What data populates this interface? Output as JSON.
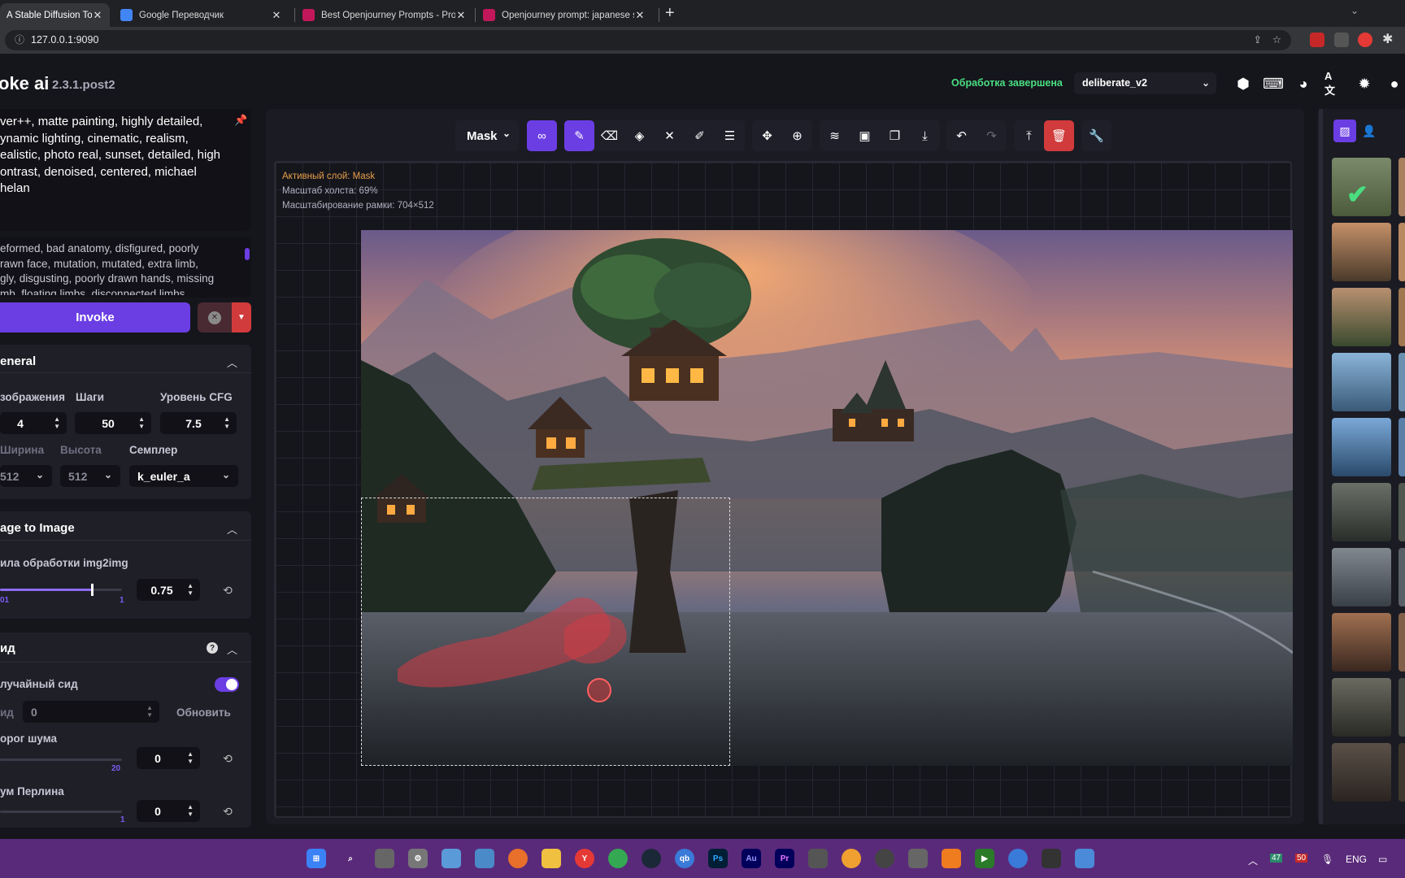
{
  "browser": {
    "tabs": [
      {
        "title": "A Stable Diffusion Too",
        "active": true,
        "favicon_color": "#202124"
      },
      {
        "title": "Google Переводчик",
        "active": false,
        "favicon_color": "#4285f4"
      },
      {
        "title": "Best Openjourney Prompts - Pro",
        "active": false,
        "favicon_color": "#c2185b"
      },
      {
        "title": "Openjourney prompt: japanese s",
        "active": false,
        "favicon_color": "#c2185b"
      }
    ],
    "new_tab": "+",
    "url": "127.0.0.1:9090"
  },
  "header": {
    "logo": "oke ai",
    "version": "2.3.1.post2",
    "status": "Обработка завершена",
    "model": "deliberate_v2"
  },
  "prompt": {
    "positive": "ver++, matte painting, highly detailed,\nynamic lighting, cinematic, realism,\nealistic, photo real, sunset, detailed, high\nontrast, denoised, centered, michael\nhelan",
    "negative": "eformed, bad anatomy, disfigured, poorly\nrawn face, mutation, mutated, extra limb,\ngly, disgusting, poorly drawn hands, missing\nmb, floating limbs, disconnected limbs"
  },
  "invoke": {
    "label": "Invoke"
  },
  "general": {
    "title": "eneral",
    "images_label": "зображения",
    "steps_label": "Шаги",
    "cfg_label": "Уровень CFG",
    "images": "4",
    "steps": "50",
    "cfg": "7.5",
    "width_label": "Ширина",
    "height_label": "Высота",
    "sampler_label": "Семплер",
    "width": "512",
    "height": "512",
    "sampler": "k_euler_a"
  },
  "img2img": {
    "title": "age to Image",
    "strength_label": "ила обработки img2img",
    "strength": "0.75",
    "slider_min": "01",
    "slider_max": "1",
    "slider_value_fraction": 0.75
  },
  "seed": {
    "title": "ид",
    "random_label": "лучайный сид",
    "random_enabled": true,
    "seed_label": "ид",
    "seed_value": "0",
    "refresh_label": "Обновить",
    "noise_threshold_label": "орог шума",
    "noise_threshold": "0",
    "noise_max": "20",
    "perlin_label": "ум Перлина",
    "perlin": "0",
    "perlin_max": "1"
  },
  "canvas": {
    "layer_select": "Mask",
    "info_active_layer": "Активный слой: Mask",
    "info_scale": "Масштаб холста: 69%",
    "info_bbox": "Масштабирование рамки: 704×512"
  },
  "taskbar": {
    "lang": "ENG",
    "badge1": "47",
    "badge2": "50"
  },
  "colors": {
    "accent": "#6b3ee4",
    "status_green": "#4ade80",
    "danger": "#d13b3b",
    "panel": "#1f1f28"
  }
}
